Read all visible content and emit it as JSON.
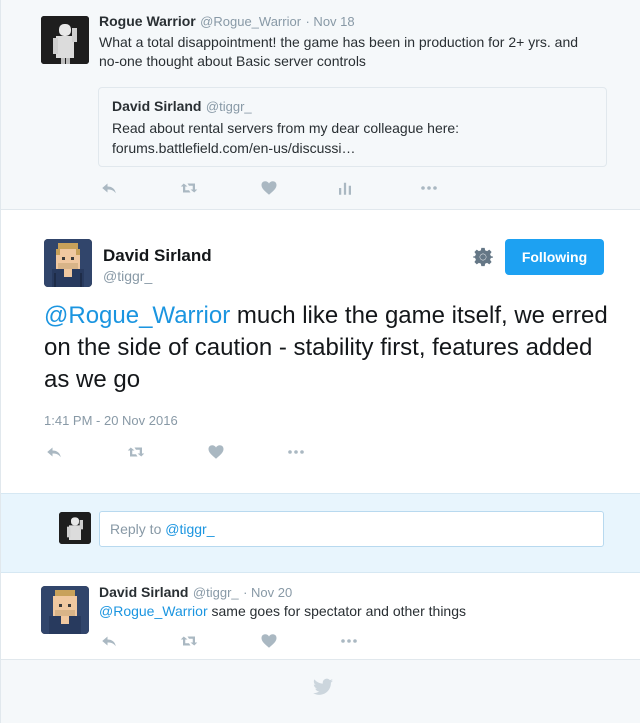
{
  "ancestor": {
    "name": "Rogue Warrior",
    "handle": "@Rogue_Warrior",
    "date": "· Nov 18",
    "text": "What a total disappointment! the game has been in production for 2+ yrs. and no-one thought about Basic server controls",
    "quote": {
      "name": "David Sirland",
      "handle": "@tiggr_",
      "line1": "Read about rental servers from my dear colleague here:",
      "line2": "forums.battlefield.com/en-us/discussi…"
    }
  },
  "main": {
    "name": "David Sirland",
    "handle": "@tiggr_",
    "follow_label": "Following",
    "mention": "@Rogue_Warrior",
    "text": " much like the game itself, we erred on the side of caution - stability first, features added as we go",
    "timestamp": "1:41 PM - 20 Nov 2016"
  },
  "reply": {
    "placeholder_prefix": "Reply to ",
    "placeholder_mention": "@tiggr_"
  },
  "reply_tweet": {
    "name": "David Sirland",
    "handle": "@tiggr_",
    "date": "· Nov 20",
    "mention": "@Rogue_Warrior",
    "text": " same goes for spectator and other things"
  },
  "icons": {
    "reply": "reply-icon",
    "retweet": "retweet-icon",
    "like": "heart-icon",
    "analytics": "analytics-icon",
    "more": "more-icon",
    "gear": "gear-icon",
    "brand": "twitter-bird-icon"
  },
  "colors": {
    "accent": "#1da1f2",
    "link": "#1b95e0",
    "muted": "#8899a6",
    "icon": "#aab8c2"
  }
}
